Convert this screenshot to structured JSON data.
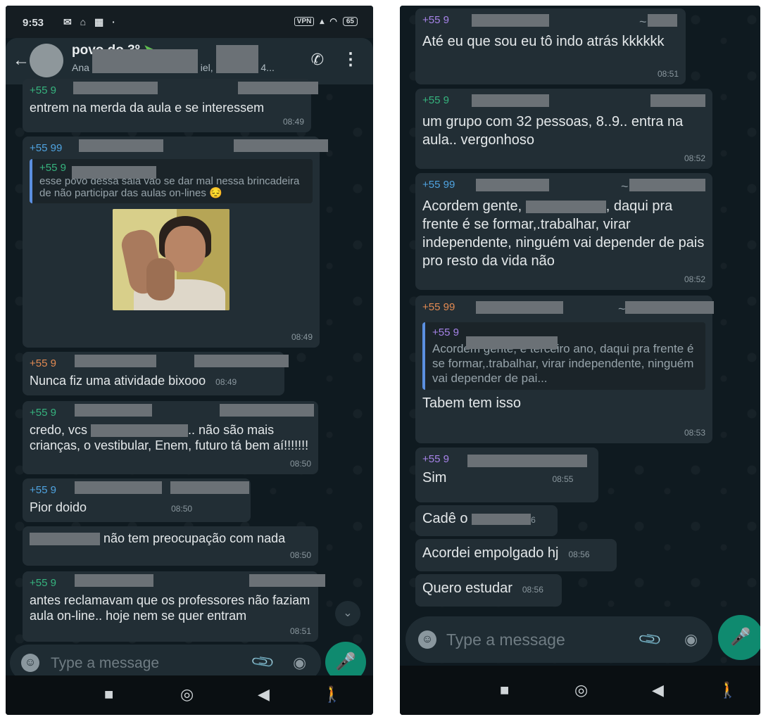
{
  "status": {
    "time": "9:53",
    "vpn": "VPN",
    "battery": "65"
  },
  "header": {
    "group_name": "povo do 3º",
    "members_prefix": "Ana",
    "members_mid": "iel,",
    "members_suffix": "4..."
  },
  "left": {
    "messages": [
      {
        "sender": "+55 9",
        "text": "entrem na merda da aula e se interessem",
        "time": "08:49"
      },
      {
        "sender": "+55 99",
        "quote_sender": "+55 9",
        "quote_text": "esse povo dessa sala vão se dar mal nessa brincadeira de não participar das aulas on-lines 😔",
        "time": "08:49"
      },
      {
        "sender": "+55 9",
        "text": "Nunca fiz uma atividade bixooo",
        "time": "08:49"
      },
      {
        "sender": "+55 9",
        "text_a": "credo, vcs",
        "text_b": ".. não são mais crianças, o vestibular, Enem, futuro tá bem aí!!!!!!!",
        "time": "08:50"
      },
      {
        "sender": "+55 9",
        "text": "Pior doido",
        "time": "08:50"
      },
      {
        "text_a": "",
        "text_b": "não tem preocupação com nada",
        "time": "08:50"
      },
      {
        "sender": "+55 9",
        "text": "antes reclamavam que os professores não faziam aula on-line.. hoje nem se quer entram",
        "time": "08:51"
      }
    ]
  },
  "right": {
    "messages": [
      {
        "sender": "+55 9",
        "tilde": "~",
        "text": "Até eu que sou eu tô indo atrás kkkkkk",
        "time": "08:51"
      },
      {
        "sender": "+55 9",
        "text": "um grupo com 32 pessoas, 8..9..  entra na aula.. vergonhoso",
        "time": "08:52"
      },
      {
        "sender": "+55 99",
        "tilde": "~",
        "text_a": "Acordem gente,",
        "text_b": ", daqui pra frente é se formar,.trabalhar, virar independente, ninguém vai depender de pais pro resto da vida não",
        "time": "08:52"
      },
      {
        "sender": "+55 99",
        "tilde": "~",
        "quote_sender": "+55 9",
        "quote_text": "Acordem gente, é terceiro ano, daqui pra frente é se formar,.trabalhar, virar independente, ninguém vai depender de pai...",
        "text": "Tabem tem isso",
        "time": "08:53"
      },
      {
        "sender": "+55 9",
        "text": "Sim",
        "time": "08:55"
      },
      {
        "text": "Cadê o",
        "time_partial": "6"
      },
      {
        "text": "Acordei empolgado hj",
        "time": "08:56"
      },
      {
        "text": "Quero estudar",
        "time": "08:56"
      }
    ]
  },
  "input": {
    "placeholder": "Type a message"
  },
  "colors": {
    "bubble": "#222e35",
    "mic": "#0f8a6f",
    "header": "#1f2c33"
  }
}
